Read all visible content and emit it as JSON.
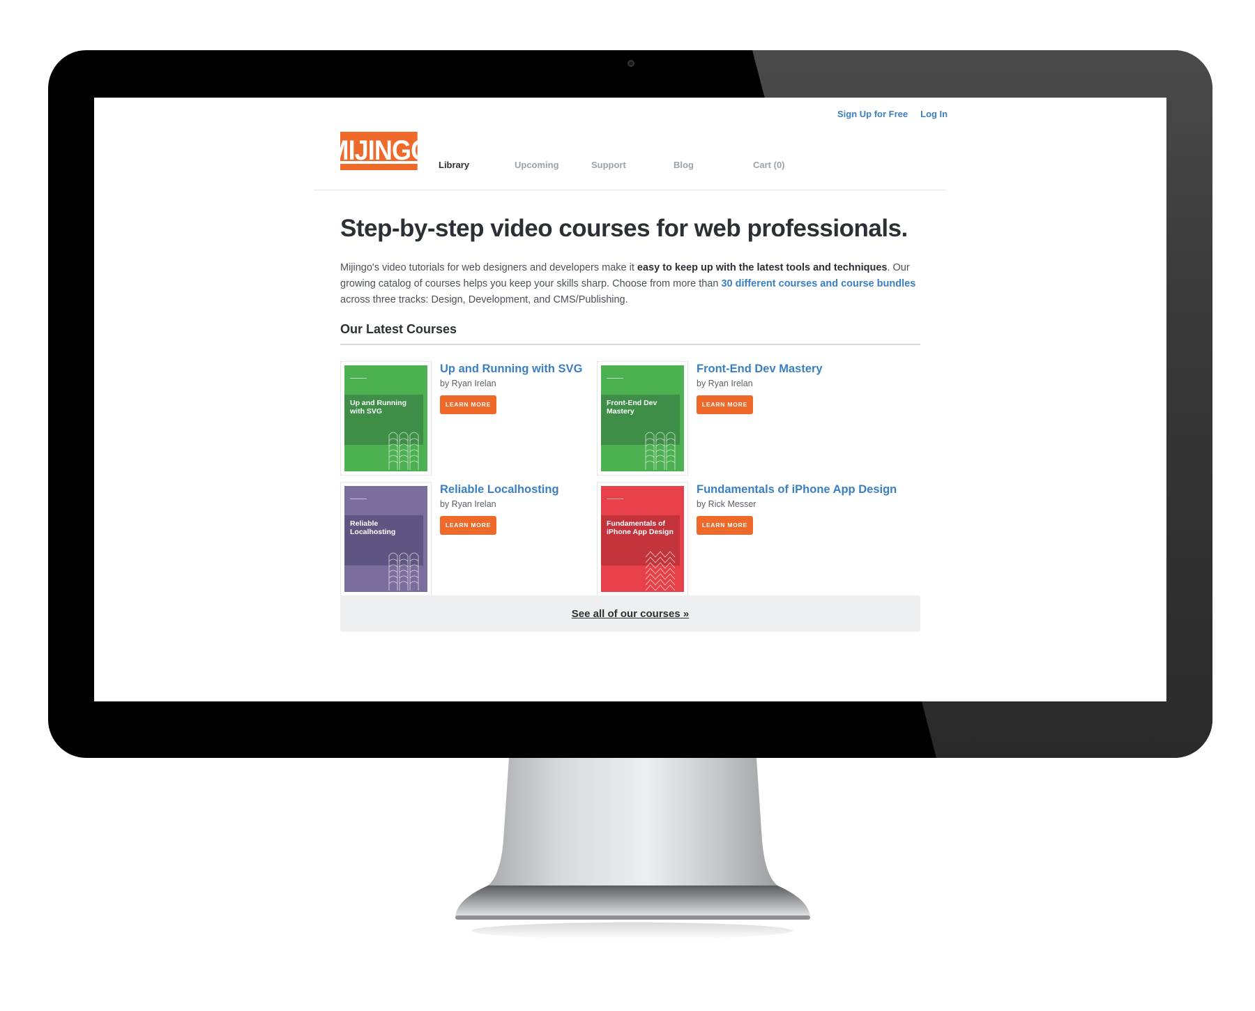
{
  "account_nav": {
    "signup": "Sign Up for Free",
    "login": "Log In"
  },
  "brand": {
    "logo_text": "MIJINGO",
    "accent": "#ef6a2a"
  },
  "nav": {
    "library": "Library",
    "upcoming": "Upcoming",
    "support": "Support",
    "blog": "Blog",
    "cart": "Cart (0)"
  },
  "hero": {
    "headline": "Step-by-step video courses for web professionals.",
    "intro_part1": "Mijingo's video tutorials for web designers and developers make it ",
    "intro_strong": "easy to keep up with the latest tools and techniques",
    "intro_part2": ". Our growing catalog of courses helps you keep your skills sharp. Choose from more than ",
    "intro_link": "30 different courses and course bundles",
    "intro_part3": " across three tracks: Design, Development, and CMS/Publishing."
  },
  "section": {
    "title": "Our Latest Courses"
  },
  "courses": [
    {
      "title": "Up and Running with SVG",
      "author": "by Ryan Irelan",
      "cta": "LEARN MORE",
      "cover_title": "Up and Running with SVG",
      "cover_color": "#4caf50",
      "band_color": "#3e8e48",
      "pattern": "arches"
    },
    {
      "title": "Front-End Dev Mastery",
      "author": "by Ryan Irelan",
      "cta": "LEARN MORE",
      "cover_title": "Front-End Dev Mastery",
      "cover_color": "#4caf50",
      "band_color": "#3e8e48",
      "pattern": "arches"
    },
    {
      "title": "Reliable Localhosting",
      "author": "by Ryan Irelan",
      "cta": "LEARN MORE",
      "cover_title": "Reliable Localhosting",
      "cover_color": "#7b6d9e",
      "band_color": "#5f5582",
      "pattern": "arches"
    },
    {
      "title": "Fundamentals of iPhone App Design",
      "author": "by Rick Messer",
      "cta": "LEARN MORE",
      "cover_title": "Fundamentals of iPhone App Design",
      "cover_color": "#e84048",
      "band_color": "#c2333b",
      "pattern": "zigzag"
    }
  ],
  "see_all": "See all of our courses »"
}
